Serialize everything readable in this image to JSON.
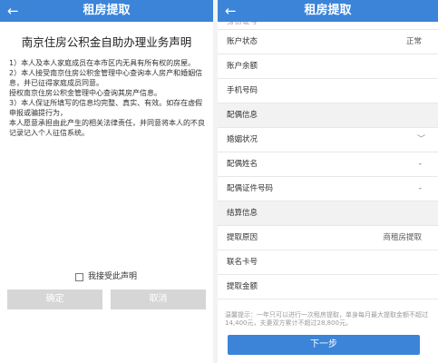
{
  "left": {
    "appbar": {
      "back": "←",
      "title": "租房提取"
    },
    "heading": "南京住房公积金自助办理业务声明",
    "paragraphs": [
      "1）本人及本人家庭成员在本市区内无具有所有权的房屋。",
      "2）本人接受南京住房公积金管理中心查询本人房产和婚姻信息，并已征得家庭成员同意。",
      "授权南京住房公积金管理中心查询其房产信息。",
      "3）本人保证所填写的信息均完整、真实、有效。如存在虚假申报或骗提行为，",
      "本人愿意承担由此产生的相关法律责任，并同意将本人的不良记录记入个人征信系统。"
    ],
    "agree_label": "我接受此声明",
    "confirm_label": "确定",
    "cancel_label": "取消"
  },
  "right": {
    "appbar": {
      "back": "←",
      "title": "租房提取"
    },
    "partial_row_label": "身份证号",
    "rows": {
      "account_status": {
        "label": "账户状态",
        "value": "正常"
      },
      "account_balance": {
        "label": "账户余额",
        "value": ""
      },
      "phone": {
        "label": "手机号码",
        "value": ""
      },
      "spouse_section": "配偶信息",
      "marital_status": {
        "label": "婚姻状况",
        "chevron": "﹀"
      },
      "spouse_name": {
        "label": "配偶姓名",
        "value": "-"
      },
      "spouse_id": {
        "label": "配偶证件号码",
        "value": "-"
      },
      "settle_section": "结算信息",
      "reason": {
        "label": "提取原因",
        "value": "商租房提取"
      },
      "card": {
        "label": "联名卡号",
        "value": ""
      },
      "amount": {
        "label": "提取金额",
        "value": ""
      }
    },
    "note": "温馨提示：一年只可以进行一次租房提取，单身每月最大提取金额不超过14,400元，夫妻双方累计不超过28,800元。",
    "next_label": "下一步"
  }
}
